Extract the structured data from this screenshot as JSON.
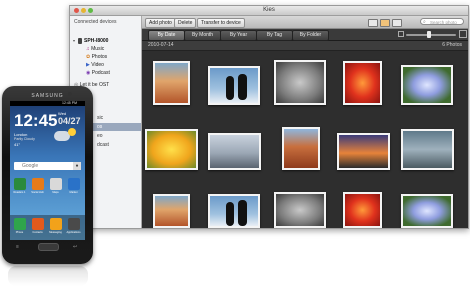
{
  "window": {
    "title": "Kies"
  },
  "sidebar": {
    "header": "Connected devices",
    "device": "SPH-I8000",
    "items": [
      {
        "label": "Music"
      },
      {
        "label": "Photos"
      },
      {
        "label": "Video"
      },
      {
        "label": "Podcast"
      }
    ],
    "item_letitbe": "Let it be  OST",
    "fragment1": "sic",
    "fragment2": "os",
    "fragment3": "eo",
    "fragment4": "dcast"
  },
  "toolbar": {
    "add_label": "Add photo",
    "delete_label": "Delete",
    "transfer_label": "Transfer to device",
    "search_placeholder": "Search photo"
  },
  "tabs": [
    {
      "label": "By Date"
    },
    {
      "label": "By Month"
    },
    {
      "label": "By Year"
    },
    {
      "label": "By Tag"
    },
    {
      "label": "By Folder"
    }
  ],
  "content": {
    "date": "2010-07-14",
    "count": "6 Photos"
  },
  "photos": [
    {
      "name": "canyon"
    },
    {
      "name": "penguins"
    },
    {
      "name": "koala"
    },
    {
      "name": "red-flower"
    },
    {
      "name": "hydrangea"
    },
    {
      "name": "tulips"
    },
    {
      "name": "lighthouse"
    },
    {
      "name": "desert"
    },
    {
      "name": "sunset"
    },
    {
      "name": "jellyfish"
    }
  ],
  "phone": {
    "brand": "SAMSUNG",
    "status_time": "12:45 PM",
    "clock": "12:45",
    "weekday": "Wed",
    "date": "04/27",
    "city": "London",
    "weather": "Partly Cloudy",
    "temp": "41°",
    "search": "Google",
    "apps_row1": [
      "Readers 1",
      "Social Hub",
      "Maps",
      "Market"
    ],
    "dock": [
      "Phone",
      "Contacts",
      "Messaging",
      "Applications"
    ]
  }
}
